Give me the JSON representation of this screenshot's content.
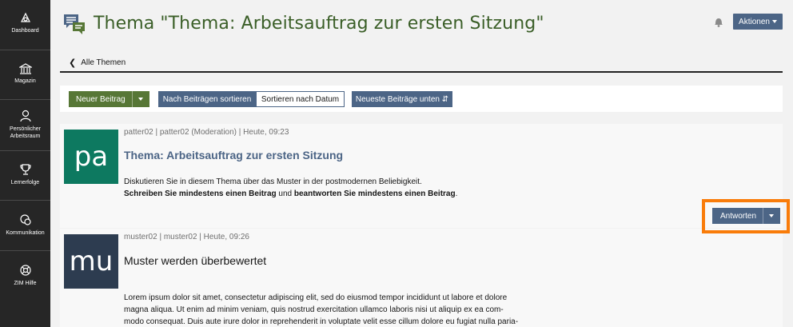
{
  "sidebar": {
    "items": [
      {
        "label": "Dashboard",
        "icon": "dashboard-icon"
      },
      {
        "label": "Magazin",
        "icon": "magazine-icon"
      },
      {
        "label": "Persönlicher Arbeitsraum",
        "icon": "person-icon"
      },
      {
        "label": "Lernerfolge",
        "icon": "trophy-icon"
      },
      {
        "label": "Kommunikation",
        "icon": "chat-icon"
      },
      {
        "label": "ZIM Hilfe",
        "icon": "help-icon"
      }
    ]
  },
  "header": {
    "title": "Thema \"Thema: Arbeitsauftrag zur ersten Sitzung\"",
    "actions_label": "Aktionen"
  },
  "back_link": "Alle Themen",
  "toolbar": {
    "new_post": "Neuer Beitrag",
    "sort_posts": "Nach Beiträgen sortieren",
    "sort_date": "Sortieren nach Datum",
    "newest_bottom": "Neueste Beiträge unten ⇵"
  },
  "posts": [
    {
      "avatar": "pa",
      "avatar_color": "#0d7960",
      "meta": "patter02 | patter02 (Moderation) | Heute, 09:23",
      "title": "Thema: Arbeitsauftrag zur ersten Sitzung",
      "line1": "Diskutieren Sie in diesem Thema über das Muster in der postmodernen Beliebigkeit.",
      "line2_bold1": "Schreiben Sie mindestens einen Beitrag",
      "line2_mid": " und ",
      "line2_bold2": "beantworten Sie mindestens einen Beitrag",
      "line2_end": ".",
      "reply_label": "Antworten"
    },
    {
      "avatar": "mu",
      "avatar_color": "#2d3c50",
      "meta": "muster02 | muster02 | Heute, 09:26",
      "title": "Muster werden überbewertet",
      "lines": [
        "Lorem ipsum dolor sit amet, consectetur adipiscing elit, sed do eiusmod tempor incididunt ut labore et dolore",
        "magna aliqua. Ut enim ad minim veniam, quis nostrud exercitation ullamco laboris nisi ut aliquip ex ea com-",
        "modo consequat. Duis aute irure dolor in reprehenderit in voluptate velit esse cillum dolore eu fugiat nulla paria-"
      ]
    }
  ],
  "colors": {
    "accent": "#4c6586",
    "green": "#577736",
    "highlight": "#f97c0a"
  }
}
